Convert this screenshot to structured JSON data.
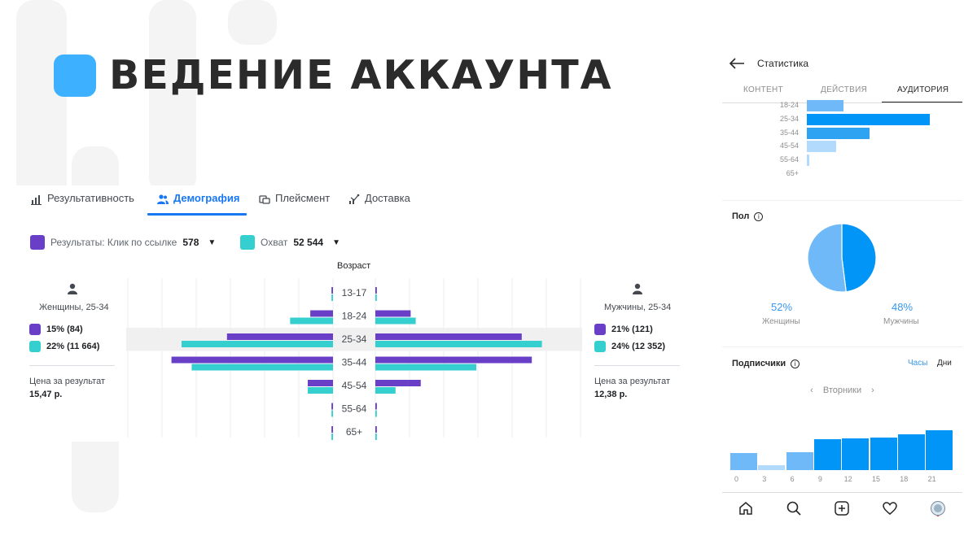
{
  "title": "ВЕДЕНИЕ АККАУНТА",
  "facebook": {
    "tabs": [
      {
        "label": "Результативность",
        "icon": "bar-chart-icon"
      },
      {
        "label": "Демография",
        "icon": "people-icon"
      },
      {
        "label": "Плейсмент",
        "icon": "placement-icon"
      },
      {
        "label": "Доставка",
        "icon": "delivery-icon"
      }
    ],
    "active_tab": "Демография",
    "legend": [
      {
        "label": "Результаты: Клик по ссылке",
        "value": "578",
        "color": "#6a3fc8"
      },
      {
        "label": "Охват",
        "value": "52 544",
        "color": "#36cfd0"
      }
    ],
    "age_title": "Возраст",
    "women": {
      "name": "Женщины, 25-34",
      "result": "15% (84)",
      "reach": "22% (11 664)",
      "cost_label": "Цена за результат",
      "cost_value": "15,47 р."
    },
    "men": {
      "name": "Мужчины, 25-34",
      "result": "21% (121)",
      "reach": "24% (12 352)",
      "cost_label": "Цена за результат",
      "cost_value": "12,38 р."
    }
  },
  "chart_data": [
    {
      "type": "bar",
      "orientation": "horizontal-pyramid",
      "title": "Возраст",
      "categories": [
        "13-17",
        "18-24",
        "25-34",
        "35-44",
        "45-54",
        "55-64",
        "65+"
      ],
      "highlighted_category": "25-34",
      "series": [
        {
          "name": "Результаты: Клик по ссылке",
          "side": "women",
          "color": "#6a3fc8",
          "values": [
            0.3,
            4.5,
            21,
            32,
            5,
            0.3,
            0.3
          ]
        },
        {
          "name": "Охват",
          "side": "women",
          "color": "#36cfd0",
          "values": [
            0.3,
            8.5,
            30,
            28,
            5,
            0.3,
            0.3
          ]
        },
        {
          "name": "Результаты: Клик по ссылке",
          "side": "men",
          "color": "#6a3fc8",
          "values": [
            0.3,
            7,
            29,
            31,
            9,
            0.3,
            0.3
          ]
        },
        {
          "name": "Охват",
          "side": "men",
          "color": "#36cfd0",
          "values": [
            0.3,
            8,
            33,
            20,
            4,
            0.3,
            0.3
          ]
        }
      ]
    },
    {
      "type": "bar",
      "orientation": "horizontal",
      "categories": [
        "18-24",
        "25-34",
        "35-44",
        "45-54",
        "55-64",
        "65+"
      ],
      "values": [
        30,
        100,
        51,
        24,
        2,
        0
      ],
      "colors": [
        "#70b9f8",
        "#0095f6",
        "#2ea3f2",
        "#b2dafc",
        "#b2dafc",
        "#b2dafc"
      ]
    },
    {
      "type": "pie",
      "title": "Пол",
      "categories": [
        "Женщины",
        "Мужчины"
      ],
      "values": [
        52,
        48
      ],
      "colors": [
        "#70b9f8",
        "#0095f6"
      ]
    },
    {
      "type": "bar",
      "title": "Подписчики",
      "categories": [
        "0",
        "3",
        "6",
        "9",
        "12",
        "15",
        "18",
        "21"
      ],
      "values": [
        38,
        10,
        40,
        68,
        70,
        72,
        78,
        88
      ],
      "colors": [
        "#70b9f8",
        "#b2dafc",
        "#70b9f8",
        "#0095f6",
        "#0095f6",
        "#0095f6",
        "#0095f6",
        "#0095f6"
      ]
    }
  ],
  "instagram": {
    "header_title": "Статистика",
    "tabs": [
      "КОНТЕНТ",
      "ДЕЙСТВИЯ",
      "АУДИТОРИЯ"
    ],
    "active_tab": "АУДИТОРИЯ",
    "gender_title": "Пол",
    "women_pct": "52%",
    "women_label": "Женщины",
    "men_pct": "48%",
    "men_label": "Мужчины",
    "followers_title": "Подписчики",
    "toggle_hours": "Часы",
    "toggle_days": "Дни",
    "day_label": "Вторники",
    "nav_icons": [
      "home-icon",
      "search-icon",
      "add-post-icon",
      "heart-icon",
      "profile-icon"
    ]
  }
}
